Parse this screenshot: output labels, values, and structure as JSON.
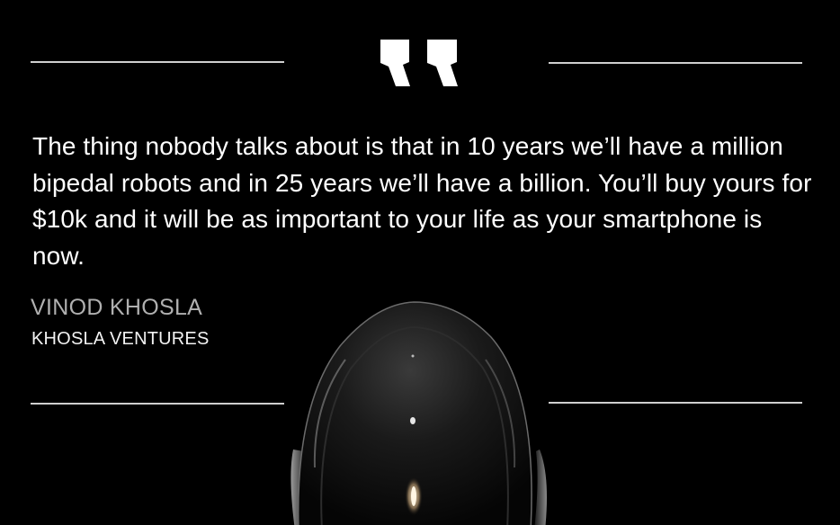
{
  "quote": {
    "text": "The thing nobody talks about is that in 10 years we’ll have a million bipedal robots and in 25 years we’ll have a billion. You’ll buy yours for $10k and it will be as important to your life as your smartphone is now."
  },
  "attribution": {
    "name": "VINOD KHOSLA",
    "organization": "KHOSLA VENTURES"
  },
  "icons": {
    "quote_mark": "quote-mark-icon",
    "illustration": "robot-head"
  },
  "colors": {
    "background": "#000000",
    "text": "#ffffff",
    "name": "#b0b0b0",
    "rule": "#cfcfcf"
  }
}
